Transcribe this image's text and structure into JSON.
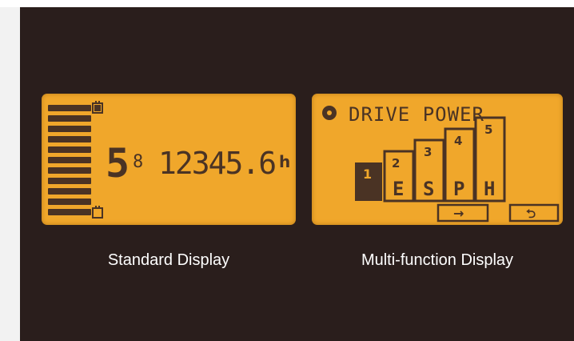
{
  "colors": {
    "panel_background": "#2a1e1c",
    "lcd_background": "#f0a72b",
    "lcd_foreground": "#4a3324",
    "accent_orange": "#f08a1c",
    "caption_text": "#ffffff"
  },
  "standard_display": {
    "caption": "Standard Display",
    "mode_digit": "5",
    "mode_small_digit": "8",
    "hour_reading": "12345.6",
    "hour_unit": "h",
    "battery_bar_segments": 10,
    "icons": [
      "battery-top-icon",
      "battery-bottom-icon"
    ]
  },
  "multi_display": {
    "caption": "Multi-function Display",
    "title": "DRIVE POWER",
    "levels": [
      {
        "number": "1",
        "letter": ""
      },
      {
        "number": "2",
        "letter": "E"
      },
      {
        "number": "3",
        "letter": "S"
      },
      {
        "number": "4",
        "letter": "P"
      },
      {
        "number": "5",
        "letter": "H"
      }
    ],
    "selected_level": "1",
    "buttons": {
      "next_arrow": "→",
      "back_arrow": "⮌"
    },
    "icons": [
      "gear-icon",
      "right-arrow-icon",
      "back-icon"
    ]
  }
}
